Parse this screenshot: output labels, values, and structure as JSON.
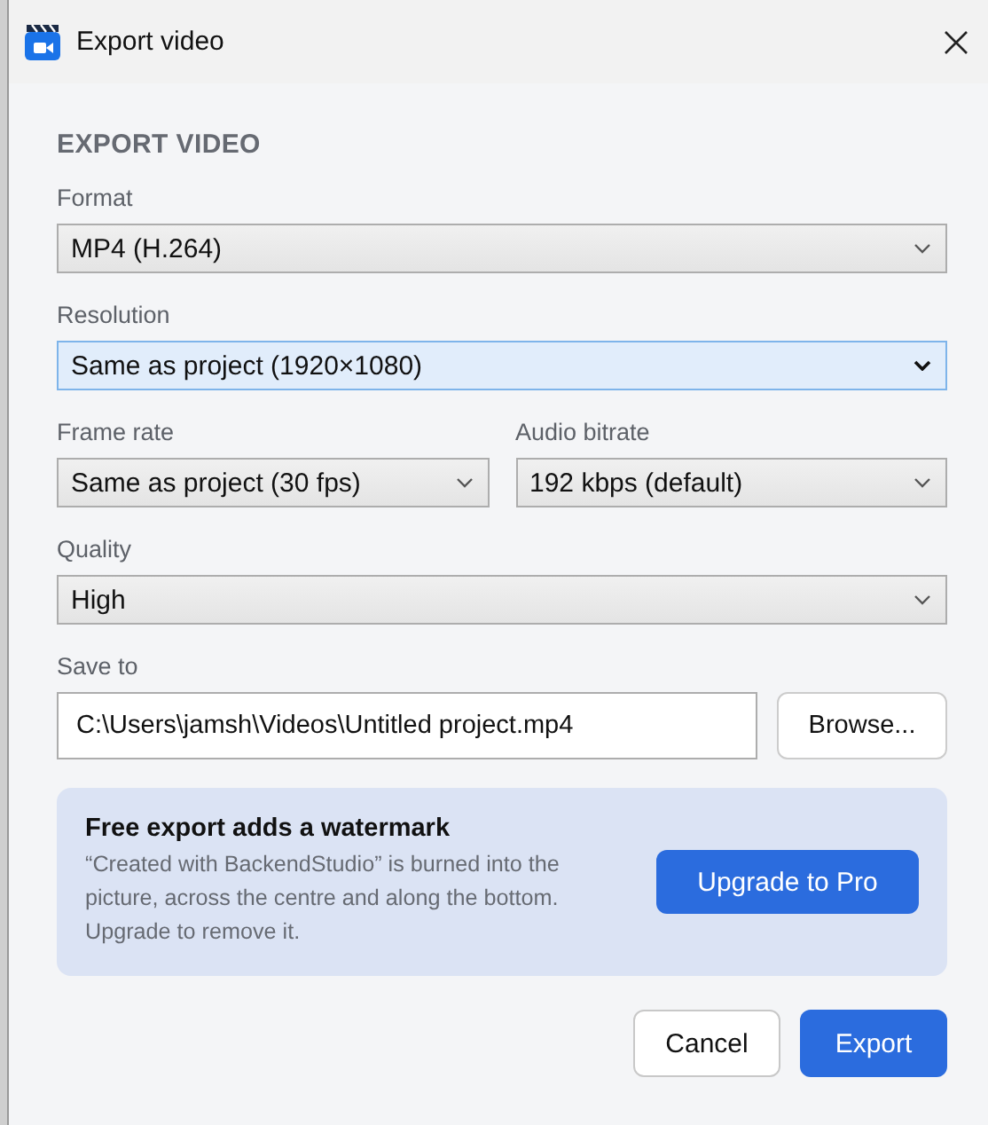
{
  "window": {
    "title": "Export video"
  },
  "heading": "EXPORT VIDEO",
  "fields": [
    {
      "kind": "select",
      "label": "Format",
      "value": "MP4 (H.264)",
      "focused": false
    },
    {
      "kind": "select",
      "label": "Resolution",
      "value": "Same as project (1920×1080)",
      "focused": true
    },
    {
      "kind": "pair",
      "items": [
        {
          "label": "Frame rate",
          "value": "Same as project (30 fps)",
          "focused": false
        },
        {
          "label": "Audio bitrate",
          "value": "192 kbps (default)",
          "focused": false
        }
      ]
    },
    {
      "kind": "select",
      "label": "Quality",
      "value": "High",
      "focused": false
    },
    {
      "kind": "path",
      "label": "Save to",
      "value": "C:\\Users\\jamsh\\Videos\\Untitled project.mp4",
      "button": "Browse..."
    }
  ],
  "notice": {
    "title": "Free export adds a watermark",
    "text": "“Created with BackendStudio” is burned into the picture, across the centre and along the bottom. Upgrade to remove it.",
    "button": "Upgrade to Pro"
  },
  "buttons": [
    {
      "label": "Cancel",
      "primary": false
    },
    {
      "label": "Export",
      "primary": true
    }
  ]
}
